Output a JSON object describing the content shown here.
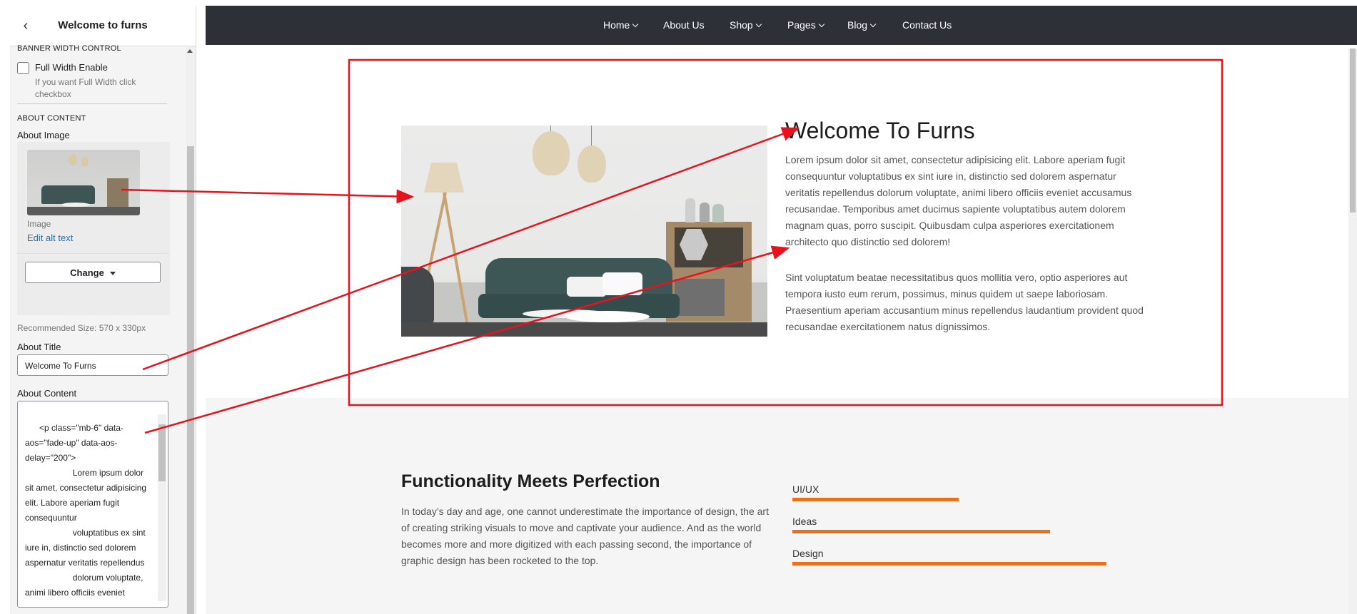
{
  "panel": {
    "title": "Welcome to furns",
    "back_icon": "chevron-left-icon",
    "banner_section": "BANNER WIDTH CONTROL",
    "full_width_label": "Full Width Enable",
    "full_width_desc": "If you want Full Width click checkbox",
    "full_width_checked": false,
    "about_section": "ABOUT CONTENT",
    "about_image_label": "About Image",
    "image_caption": "Image",
    "edit_alt_text": "Edit alt text",
    "change_button": "Change",
    "recommended_size": "Recommended Size: 570 x 330px",
    "about_title_label": "About Title",
    "about_title_value": "Welcome To Furns",
    "about_content_label": "About Content",
    "about_content_value": "<p class=\"mb-6\" data-aos=\"fade-up\" data-aos-delay=\"200\">\n                    Lorem ipsum dolor sit amet, consectetur adipisicing elit. Labore aperiam fugit consequuntur\n                    voluptatibus ex sint iure in, distinctio sed dolorem aspernatur veritatis repellendus\n                    dolorum voluptate, animi libero officiis eveniet"
  },
  "nav": {
    "items": [
      {
        "label": "Home",
        "dropdown": true
      },
      {
        "label": "About Us",
        "dropdown": false
      },
      {
        "label": "Shop",
        "dropdown": true
      },
      {
        "label": "Pages",
        "dropdown": true
      },
      {
        "label": "Blog",
        "dropdown": true
      },
      {
        "label": "Contact Us",
        "dropdown": false
      }
    ]
  },
  "about": {
    "title": "Welcome To Furns",
    "paragraph1": "Lorem ipsum dolor sit amet, consectetur adipisicing elit. Labore aperiam fugit consequuntur voluptatibus ex sint iure in, distinctio sed dolorem aspernatur veritatis repellendus dolorum voluptate, animi libero officiis eveniet accusamus recusandae. Temporibus amet ducimus sapiente voluptatibus autem dolorem magnam quas, porro suscipit. Quibusdam culpa asperiores exercitationem architecto quo distinctio sed dolorem!",
    "paragraph2": "Sint voluptatum beatae necessitatibus quos mollitia vero, optio asperiores aut tempora iusto eum rerum, possimus, minus quidem ut saepe laboriosam. Praesentium aperiam accusantium minus repellendus laudantium provident quod recusandae exercitationem natus dignissimos."
  },
  "features": {
    "title": "Functionality Meets Perfection",
    "text": "In today’s day and age, one cannot underestimate the importance of design, the art of creating striking visuals to move and captivate your audience. And as the world becomes more and more digitized with each passing second, the importance of graphic design has been rocketed to the top.",
    "skills": [
      {
        "label": "UI/UX",
        "level": 0.53
      },
      {
        "label": "Ideas",
        "level": 0.82
      },
      {
        "label": "Design",
        "level": 1.0
      }
    ]
  },
  "colors": {
    "nav_bg": "#2e3038",
    "accent_orange": "#e8721c",
    "annotation_red": "#e8121c",
    "link_blue": "#2271b1"
  }
}
